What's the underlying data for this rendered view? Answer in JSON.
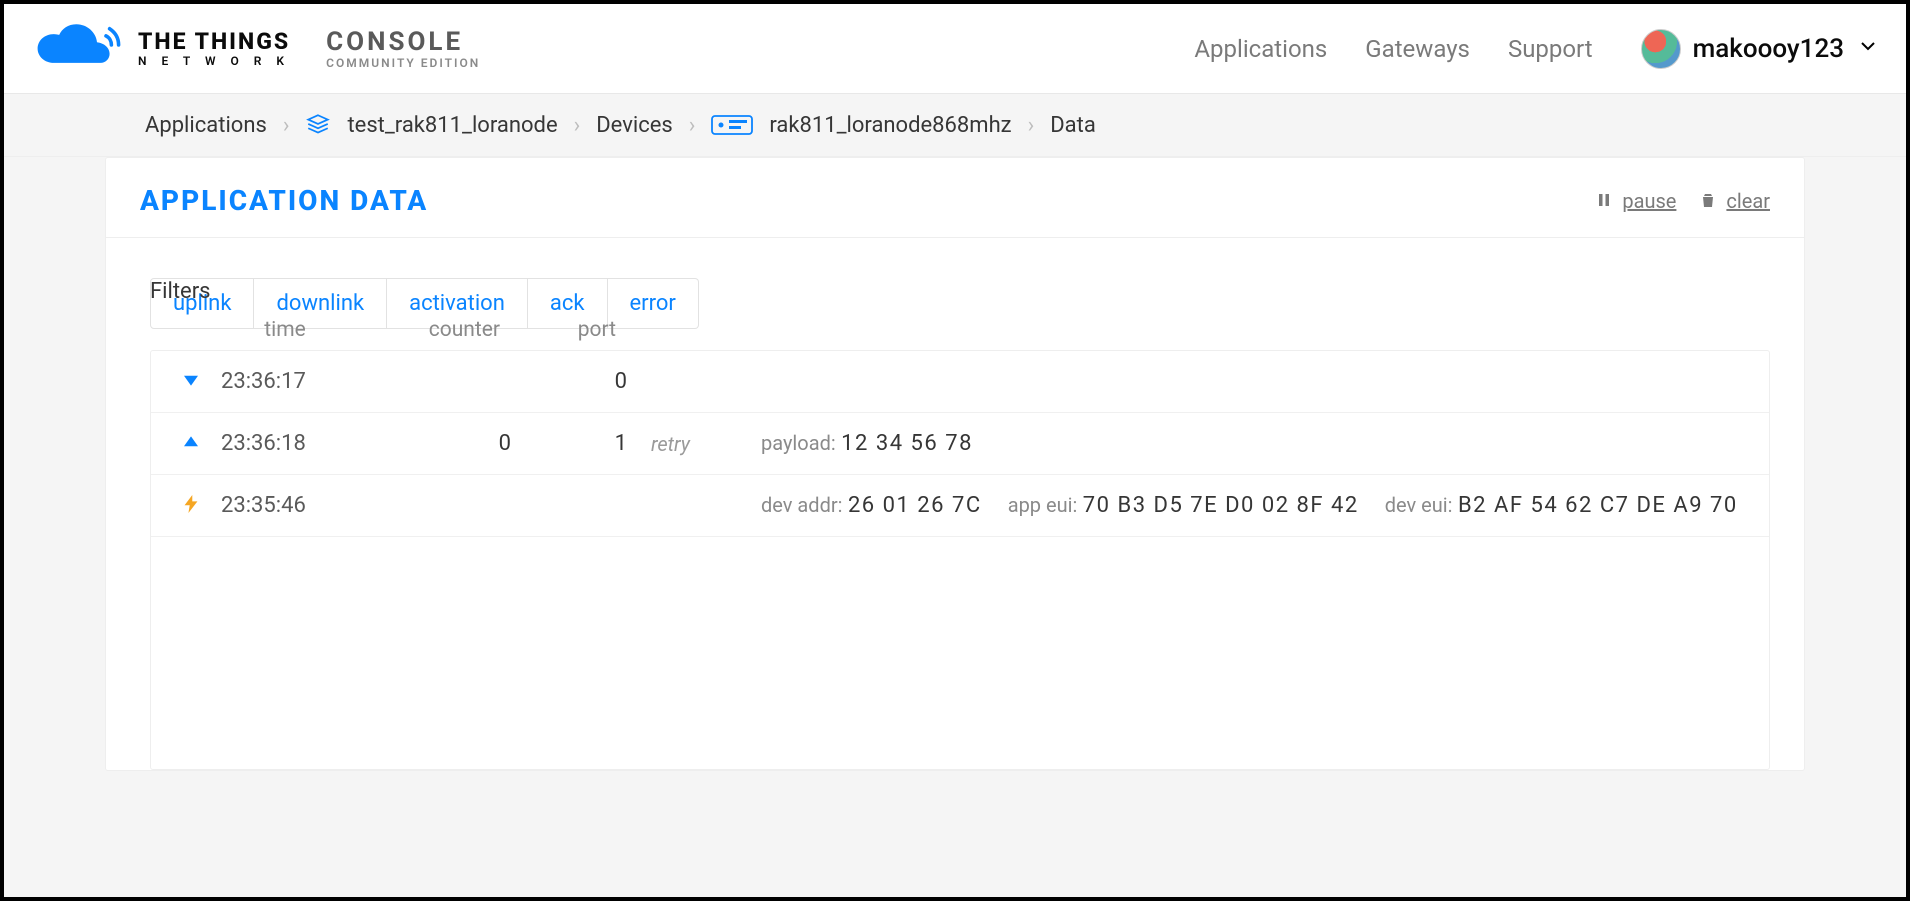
{
  "brand": {
    "line1": "THE THINGS",
    "line2": "N E T W O R K",
    "console1": "CONSOLE",
    "console2": "COMMUNITY EDITION"
  },
  "nav": {
    "applications": "Applications",
    "gateways": "Gateways",
    "support": "Support",
    "username": "makoooy123"
  },
  "breadcrumbs": {
    "applications": "Applications",
    "app_id": "test_rak811_loranode",
    "devices": "Devices",
    "device_id": "rak811_loranode868mhz",
    "data": "Data"
  },
  "card": {
    "title": "APPLICATION DATA",
    "pause": "pause",
    "clear": "clear"
  },
  "filters": {
    "label": "Filters",
    "uplink": "uplink",
    "downlink": "downlink",
    "activation": "activation",
    "ack": "ack",
    "error": "error"
  },
  "columns": {
    "time": "time",
    "counter": "counter",
    "port": "port"
  },
  "rows": [
    {
      "dir": "down",
      "time": "23:36:17",
      "counter": "",
      "port": "0",
      "flag": "",
      "segments": []
    },
    {
      "dir": "up",
      "time": "23:36:18",
      "counter": "0",
      "port": "1",
      "flag": "retry",
      "segments": [
        {
          "label": "payload:",
          "value": "12 34 56 78"
        }
      ]
    },
    {
      "dir": "bolt",
      "time": "23:35:46",
      "counter": "",
      "port": "",
      "flag": "",
      "segments": [
        {
          "label": "dev addr:",
          "value": "26 01 26 7C"
        },
        {
          "label": "app eui:",
          "value": "70 B3 D5 7E D0 02 8F 42"
        },
        {
          "label": "dev eui:",
          "value": "B2 AF 54 62 C7 DE A9 70"
        }
      ]
    }
  ]
}
